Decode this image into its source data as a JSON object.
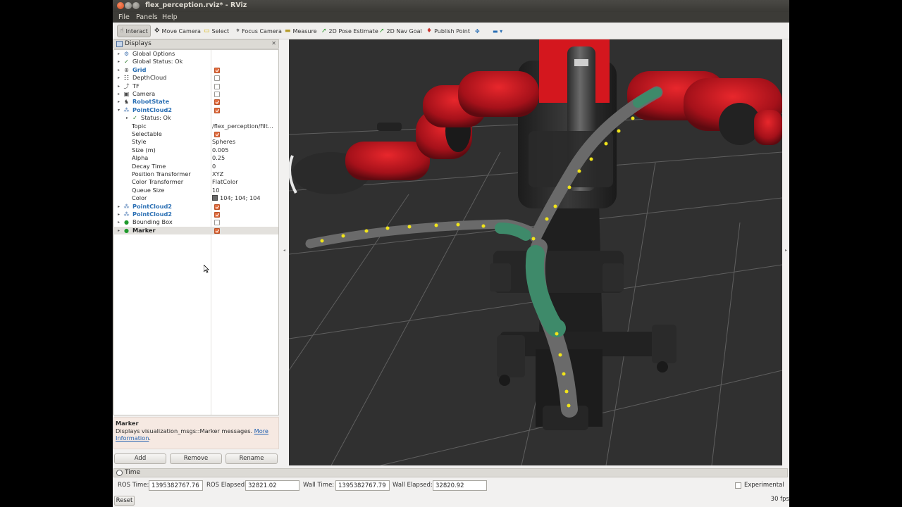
{
  "window": {
    "title": "flex_perception.rviz* - RViz"
  },
  "menu": [
    "File",
    "Panels",
    "Help"
  ],
  "toolbar": {
    "interact": "Interact",
    "move_camera": "Move Camera",
    "select": "Select",
    "focus_camera": "Focus Camera",
    "measure": "Measure",
    "pose_estimate": "2D Pose Estimate",
    "nav_goal": "2D Nav Goal",
    "publish_point": "Publish Point",
    "add_tool": "✥",
    "more": "▬ ▾"
  },
  "displays": {
    "title": "Displays",
    "close": "✕",
    "rows": [
      {
        "label": "Global Options",
        "expand": "▸",
        "icon": "⚙"
      },
      {
        "label": "Global Status: Ok",
        "expand": "▸",
        "icon": "✓"
      },
      {
        "label": "Grid",
        "expand": "▸",
        "icon": "⊕",
        "check": true
      },
      {
        "label": "DepthCloud",
        "expand": "▸",
        "icon": "☷",
        "check": false
      },
      {
        "label": "TF",
        "expand": "▸",
        "icon": "⤴",
        "check": false
      },
      {
        "label": "Camera",
        "expand": "▸",
        "icon": "▣",
        "check": false
      },
      {
        "label": "RobotState",
        "expand": "▸",
        "icon": "♞",
        "check": true
      },
      {
        "label": "PointCloud2",
        "expand": "▾",
        "icon": "⁂",
        "check": true
      },
      {
        "label": "Status: Ok",
        "expand": "▸",
        "icon": "✓"
      },
      {
        "label": "Topic",
        "value": "/flex_perception/filt..."
      },
      {
        "label": "Selectable",
        "check": true
      },
      {
        "label": "Style",
        "value": "Spheres"
      },
      {
        "label": "Size (m)",
        "value": "0.005"
      },
      {
        "label": "Alpha",
        "value": "0.25"
      },
      {
        "label": "Decay Time",
        "value": "0"
      },
      {
        "label": "Position Transformer",
        "value": "XYZ"
      },
      {
        "label": "Color Transformer",
        "value": "FlatColor"
      },
      {
        "label": "Queue Size",
        "value": "10"
      },
      {
        "label": "Color",
        "value": "104; 104; 104"
      },
      {
        "label": "PointCloud2",
        "expand": "▸",
        "icon": "⁂",
        "check": true
      },
      {
        "label": "PointCloud2",
        "expand": "▸",
        "icon": "⁂",
        "check": true
      },
      {
        "label": "Bounding Box",
        "expand": "▸",
        "icon": "●",
        "check": false
      },
      {
        "label": "Marker",
        "expand": "▸",
        "icon": "●",
        "check": true
      }
    ],
    "description": {
      "title": "Marker",
      "text": "Displays visualization_msgs::Marker messages. ",
      "link1": "More",
      "link2": "Information",
      "tail": "."
    },
    "buttons": {
      "add": "Add",
      "remove": "Remove",
      "rename": "Rename"
    }
  },
  "time": {
    "title": "Time",
    "ros_time_label": "ROS Time:",
    "ros_time": "1395382767.76",
    "ros_elapsed_label": "ROS Elapsed:",
    "ros_elapsed": "32821.02",
    "wall_time_label": "Wall Time:",
    "wall_time": "1395382767.79",
    "wall_elapsed_label": "Wall Elapsed:",
    "wall_elapsed": "32820.92",
    "experimental": "Experimental",
    "reset": "Reset",
    "fps": "30 fps"
  },
  "colors": {
    "point_cloud": "#686868",
    "accent_check": "#e46d3e",
    "robot_red": "#b5161b",
    "segment_green": "#3e8a6a",
    "marker_yellow": "#f0e41a"
  }
}
